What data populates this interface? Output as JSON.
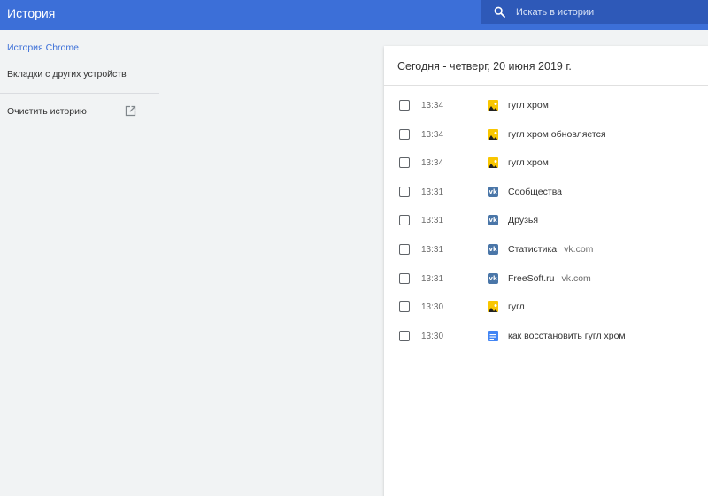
{
  "header": {
    "title": "История",
    "search_placeholder": "Искать в истории"
  },
  "sidebar": {
    "items": [
      {
        "label": "История Chrome",
        "active": true
      },
      {
        "label": "Вкладки с других устройств"
      },
      {
        "label": "Очистить историю"
      }
    ]
  },
  "history": {
    "date_heading": "Сегодня - четверг, 20 июня 2019 г.",
    "entries": [
      {
        "time": "13:34",
        "title": "гугл хром",
        "domain": "",
        "icon": "image-icon"
      },
      {
        "time": "13:34",
        "title": "гугл хром обновляется",
        "domain": "",
        "icon": "image-icon"
      },
      {
        "time": "13:34",
        "title": "гугл хром",
        "domain": "",
        "icon": "image-icon"
      },
      {
        "time": "13:31",
        "title": "Сообщества",
        "domain": "",
        "icon": "vk-icon"
      },
      {
        "time": "13:31",
        "title": "Друзья",
        "domain": "",
        "icon": "vk-icon"
      },
      {
        "time": "13:31",
        "title": "Статистика",
        "domain": "vk.com",
        "icon": "vk-icon"
      },
      {
        "time": "13:31",
        "title": "FreeSoft.ru",
        "domain": "vk.com",
        "icon": "vk-icon"
      },
      {
        "time": "13:30",
        "title": "гугл",
        "domain": "",
        "icon": "image-icon"
      },
      {
        "time": "13:30",
        "title": "как восстановить гугл хром",
        "domain": "",
        "icon": "document-icon"
      }
    ]
  },
  "colors": {
    "header_bg": "#3c6fd8",
    "search_bg": "#2e59b8",
    "accent": "#3c6fd8",
    "page_bg": "#f1f3f4"
  }
}
